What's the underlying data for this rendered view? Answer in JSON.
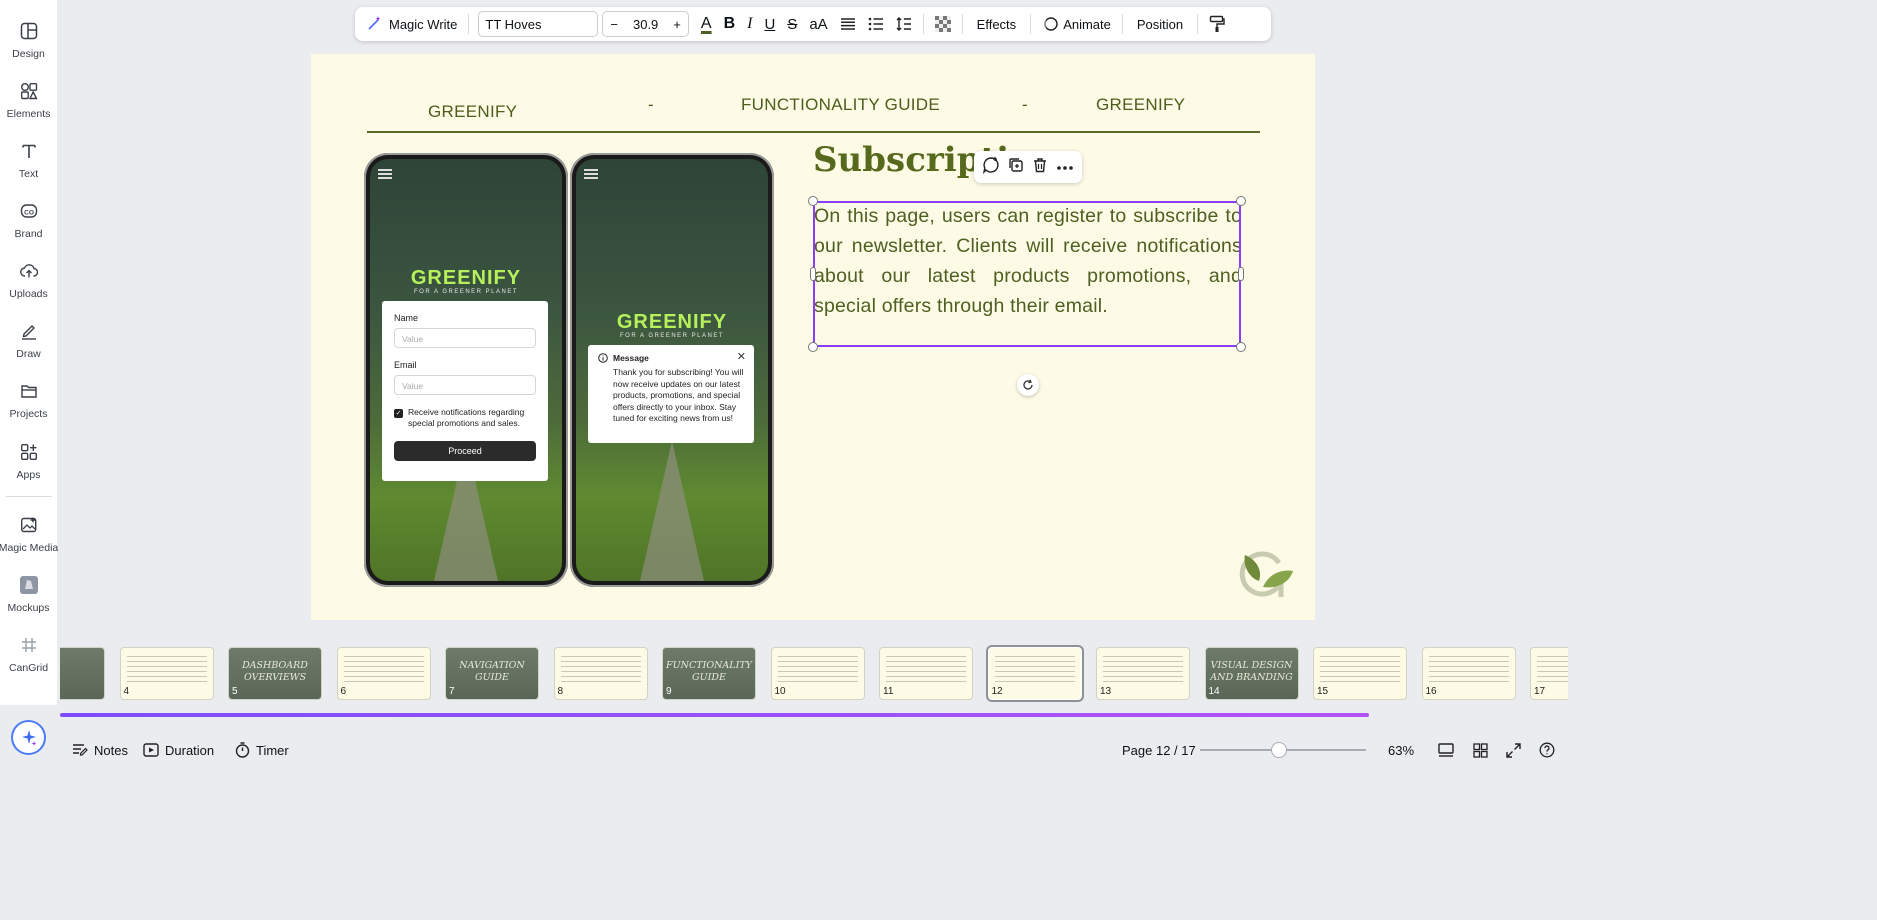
{
  "sidebar": {
    "items": [
      {
        "label": "Design",
        "icon": "design-icon"
      },
      {
        "label": "Elements",
        "icon": "elements-icon"
      },
      {
        "label": "Text",
        "icon": "text-icon"
      },
      {
        "label": "Brand",
        "icon": "brand-icon"
      },
      {
        "label": "Uploads",
        "icon": "uploads-icon"
      },
      {
        "label": "Draw",
        "icon": "draw-icon"
      },
      {
        "label": "Projects",
        "icon": "projects-icon"
      },
      {
        "label": "Apps",
        "icon": "apps-icon"
      },
      {
        "label": "Magic Media",
        "icon": "magic-media-icon"
      },
      {
        "label": "Mockups",
        "icon": "mockups-icon"
      },
      {
        "label": "CanGrid",
        "icon": "cangrid-icon"
      }
    ]
  },
  "toolbar": {
    "magic_write": "Magic Write",
    "font": "TT Hoves",
    "minus": "−",
    "size": "30.9",
    "plus": "+",
    "color_glyph": "A",
    "bold": "B",
    "italic": "I",
    "underline": "U",
    "strike": "S",
    "case": "aA",
    "effects": "Effects",
    "animate": "Animate",
    "position": "Position",
    "text_color": "#4e5f22"
  },
  "slide": {
    "header_left": "GREENIFY",
    "header_dash1": "-",
    "header_center": "FUNCTIONALITY GUIDE",
    "header_dash2": "-",
    "header_right": "GREENIFY",
    "title": "Subscriptio",
    "body": "On this page, users can register to subscribe to our newsletter. Clients will receive notifications about our latest products promotions, and special offers through their email."
  },
  "phone1": {
    "logo": "GREENIFY",
    "logo_sub": "FOR A GREENER PLANET",
    "name_label": "Name",
    "name_placeholder": "Value",
    "email_label": "Email",
    "email_placeholder": "Value",
    "checkbox_label": "Receive notifications regarding special promotions and sales.",
    "proceed": "Proceed"
  },
  "phone2": {
    "logo": "GREENIFY",
    "logo_sub": "FOR A GREENER PLANET",
    "msg_title": "Message",
    "msg_body": "Thank you for subscribing! You will now receive updates on our latest products, promotions, and special offers directly to your inbox. Stay tuned for exciting news from us!",
    "close": "✕"
  },
  "thumbnails": [
    {
      "num": "",
      "caption": "",
      "style": "dark"
    },
    {
      "num": "4",
      "caption": "",
      "style": "light"
    },
    {
      "num": "5",
      "caption": "DASHBOARD OVERVIEWS",
      "style": "dark"
    },
    {
      "num": "6",
      "caption": "",
      "style": "light"
    },
    {
      "num": "7",
      "caption": "NAVIGATION GUIDE",
      "style": "dark"
    },
    {
      "num": "8",
      "caption": "",
      "style": "light"
    },
    {
      "num": "9",
      "caption": "FUNCTIONALITY GUIDE",
      "style": "dark"
    },
    {
      "num": "10",
      "caption": "",
      "style": "light"
    },
    {
      "num": "11",
      "caption": "",
      "style": "light"
    },
    {
      "num": "12",
      "caption": "",
      "style": "light",
      "active": true
    },
    {
      "num": "13",
      "caption": "",
      "style": "light"
    },
    {
      "num": "14",
      "caption": "VISUAL DESIGN AND BRANDING",
      "style": "dark"
    },
    {
      "num": "15",
      "caption": "",
      "style": "light"
    },
    {
      "num": "16",
      "caption": "",
      "style": "light"
    },
    {
      "num": "17",
      "caption": "",
      "style": "light"
    }
  ],
  "bottom": {
    "notes": "Notes",
    "duration": "Duration",
    "timer": "Timer",
    "page_info": "Page 12 / 17",
    "zoom": "63%"
  },
  "colors": {
    "accent": "#8b3dff",
    "slide_bg": "#fdfbe6",
    "slide_text": "#4e5f22"
  }
}
